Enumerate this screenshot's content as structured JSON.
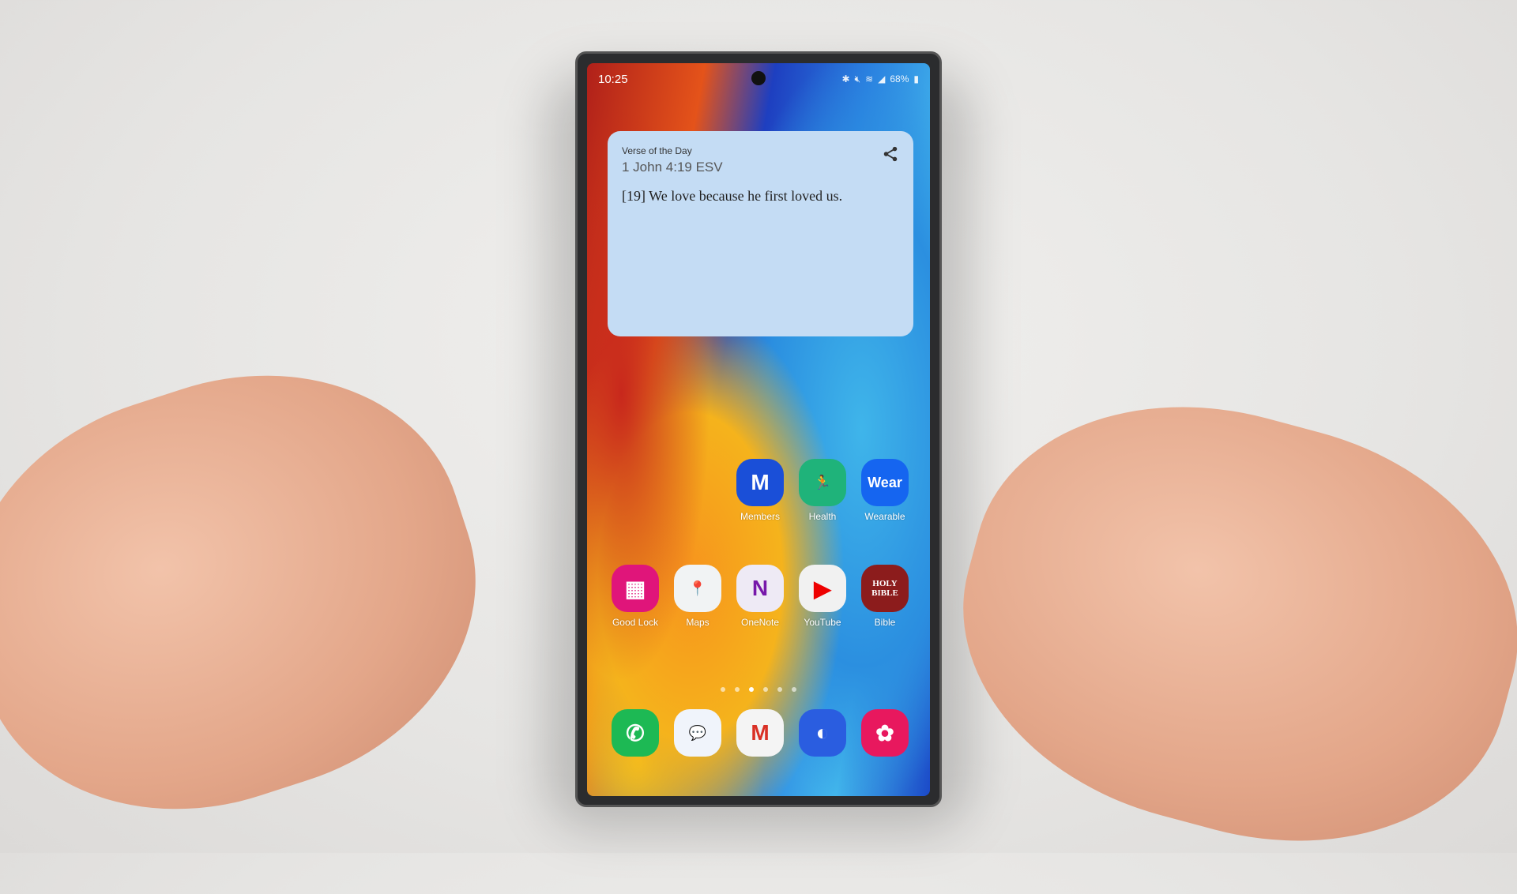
{
  "status_bar": {
    "time": "10:25",
    "battery": "68%",
    "icons": [
      "bluetooth-icon",
      "mute-icon",
      "wifi-icon",
      "signal-icon",
      "battery-icon"
    ]
  },
  "widget": {
    "title": "Verse of the Day",
    "reference": "1 John 4:19 ESV",
    "verse": "[19] We love because he first loved us.",
    "share_icon": "share-icon"
  },
  "apps_row1": [
    {
      "label": "Members",
      "glyph": "M",
      "color": "#1a4fd8"
    },
    {
      "label": "Health",
      "glyph": "🏃",
      "color": "#1fb37a"
    },
    {
      "label": "Wearable",
      "glyph": "Wear",
      "color": "#1565f0"
    }
  ],
  "apps_row2": [
    {
      "label": "Good Lock",
      "glyph": "▦",
      "color": "#e0157a"
    },
    {
      "label": "Maps",
      "glyph": "📍",
      "color": "#f1f3f4"
    },
    {
      "label": "OneNote",
      "glyph": "N",
      "color": "#eeeaf5"
    },
    {
      "label": "YouTube",
      "glyph": "▶",
      "color": "#f1f1f1"
    },
    {
      "label": "Bible",
      "glyph": "HOLY BIBLE",
      "color": "#8c1c1c"
    }
  ],
  "dock": [
    {
      "name": "phone",
      "glyph": "✆",
      "color": "#1db954"
    },
    {
      "name": "messages",
      "glyph": "💬",
      "color": "#f0f4fb"
    },
    {
      "name": "gmail",
      "glyph": "M",
      "color": "#f4f4f4"
    },
    {
      "name": "internet",
      "glyph": "◐",
      "color": "#2a5de0"
    },
    {
      "name": "gallery",
      "glyph": "✿",
      "color": "#e8185e"
    }
  ],
  "page_indicator": {
    "count": 6,
    "active": 2
  }
}
